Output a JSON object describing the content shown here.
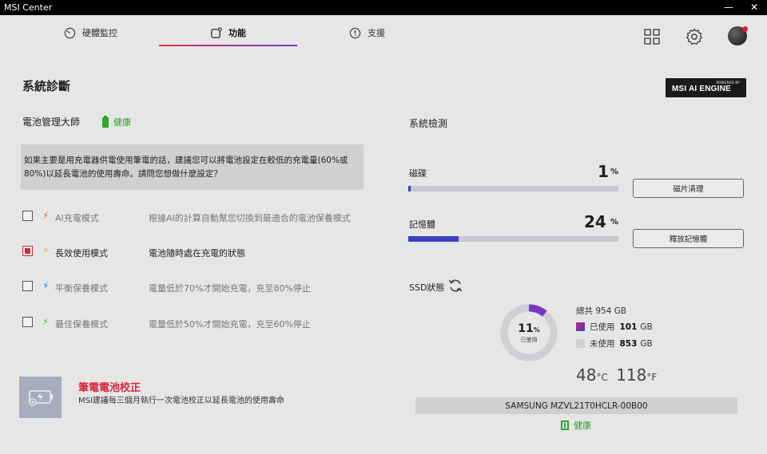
{
  "titlebar": {
    "title": "MSI Center",
    "minimize": "—",
    "close": "✕"
  },
  "tabs": [
    {
      "label": "硬體監控",
      "icon": "gauge-icon"
    },
    {
      "label": "功能",
      "icon": "feature-icon",
      "active": true
    },
    {
      "label": "支援",
      "icon": "alert-circle-icon"
    }
  ],
  "header_icons": [
    "apps-grid-icon",
    "gear-icon",
    "avatar"
  ],
  "page_title": "系統診斷",
  "ai_badge": {
    "top": "POWERED BY",
    "main": "MSI AI ENGINE"
  },
  "battery": {
    "title": "電池管理大師",
    "status": "健康",
    "info": "如果主要是用充電器供電使用筆電的話，建議您可以將電池設定在較低的充電量(60%或80%)以延長電池的使用壽命。請問您想做什麼設定？",
    "options": [
      {
        "label": "AI充電模式",
        "desc": "根據AI的計算自動幫您切換到最適合的電池保養模式",
        "checked": false,
        "bolt_color": "#e0703a"
      },
      {
        "label": "長效使用模式",
        "desc": "電池隨時處在充電的狀態",
        "checked": true,
        "bolt_color": "#f0b020"
      },
      {
        "label": "平衡保養模式",
        "desc": "電量低於70%才開始充電，充至80%停止",
        "checked": false,
        "bolt_color": "#2a8ae0"
      },
      {
        "label": "最佳保養模式",
        "desc": "電量低於50%才開始充電，充至60%停止",
        "checked": false,
        "bolt_color": "#4ab83a"
      }
    ],
    "calibration": {
      "title": "筆電電池校正",
      "desc": "MSI建議每三個月執行一次電池校正以延長電池的使用壽命"
    }
  },
  "system": {
    "title": "系統檢測",
    "disk": {
      "label": "磁碟",
      "value": "1",
      "unit": "%",
      "percent": 1,
      "button": "磁片清理"
    },
    "memory": {
      "label": "記憶體",
      "value": "24",
      "unit": "%",
      "percent": 24,
      "button": "釋放記憶體"
    },
    "ssd": {
      "label": "SSD狀態",
      "used_percent": 11,
      "used_percent_text": "11",
      "pct_unit": "%",
      "used_sub": "已使用",
      "total_text": "總共 954 GB",
      "used_label": "已使用",
      "used_value": "101",
      "unused_label": "未使用",
      "unused_value": "853",
      "gb": "GB",
      "temp_c": "48",
      "unit_c": "°C",
      "temp_f": "118",
      "unit_f": "°F",
      "model": "SAMSUNG MZVL21T0HCLR-00B00",
      "health": "健康"
    }
  },
  "colors": {
    "accent_red": "#d8253a",
    "bar_blue": "#3b3fc4",
    "donut_purple": "#7a35c8",
    "health_green": "#2e9b2e"
  }
}
